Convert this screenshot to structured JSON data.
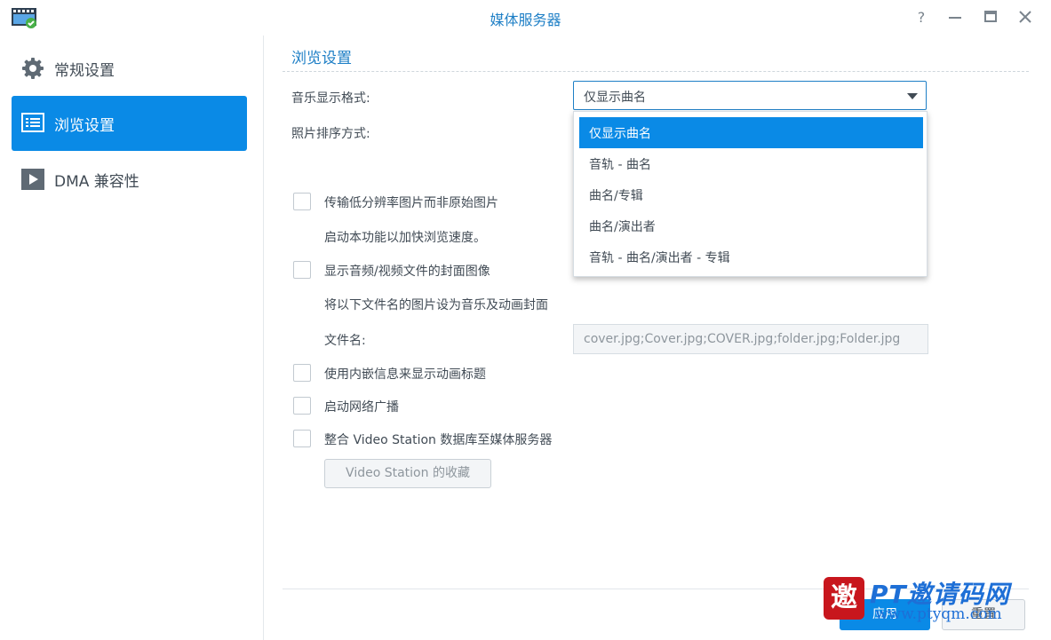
{
  "window": {
    "title": "媒体服务器"
  },
  "sidebar": {
    "items": [
      {
        "label": "常规设置",
        "icon": "gear-icon",
        "active": false
      },
      {
        "label": "浏览设置",
        "icon": "list-icon",
        "active": true
      },
      {
        "label": "DMA 兼容性",
        "icon": "play-icon",
        "active": false
      }
    ]
  },
  "content": {
    "section_title": "浏览设置",
    "music_format": {
      "label": "音乐显示格式:",
      "value": "仅显示曲名",
      "options": [
        "仅显示曲名",
        "音轨 - 曲名",
        "曲名/专辑",
        "曲名/演出者",
        "音轨 - 曲名/演出者 - 专辑"
      ]
    },
    "photo_sort": {
      "label": "照片排序方式:"
    },
    "options": {
      "low_res": {
        "label": "传输低分辨率图片而非原始图片",
        "checked": false
      },
      "low_res_hint": "启动本功能以加快浏览速度。",
      "cover_image": {
        "label": "显示音频/视频文件的封面图像",
        "checked": false
      },
      "cover_hint": "将以下文件名的图片设为音乐及动画封面",
      "filename_label": "文件名:",
      "filename_value": "cover.jpg;Cover.jpg;COVER.jpg;folder.jpg;Folder.jpg",
      "embedded_title": {
        "label": "使用内嵌信息来显示动画标题",
        "checked": false
      },
      "network_broadcast": {
        "label": "启动网络广播",
        "checked": false
      },
      "video_station": {
        "label": "整合 Video Station 数据库至媒体服务器",
        "checked": false
      },
      "video_station_button": "Video Station 的收藏"
    }
  },
  "footer": {
    "apply": "应用",
    "reset": "重置"
  },
  "watermark": {
    "seal": "邀",
    "title": "PT邀请码网",
    "url": "www.ptyqm.com"
  },
  "colors": {
    "accent": "#0a8ae6",
    "title_blue": "#1e7fc6",
    "text": "#414b55"
  }
}
